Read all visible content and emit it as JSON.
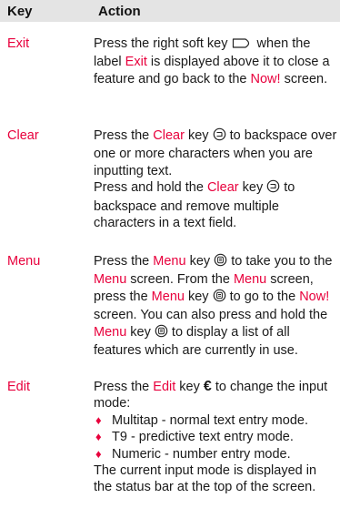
{
  "header": {
    "key": "Key",
    "action": "Action"
  },
  "entries": [
    {
      "key": "Exit",
      "p1_a": "Press the right soft key ",
      "icon": "right-soft-key-icon",
      "p1_b": " when the label ",
      "p1_hl": "Exit",
      "p1_c": " is displayed above it to close a feature and go back to the ",
      "p1_hl2": "Now!",
      "p1_d": " screen."
    },
    {
      "key": "Clear",
      "p1_a": "Press the ",
      "p1_hl": "Clear",
      "p1_b": " key ",
      "icon": "clear-key-icon",
      "p1_c": " to backspace over one or more characters when you are inputting text.",
      "p2_a": "Press and hold the ",
      "p2_hl": "Clear",
      "p2_b": " key ",
      "p2_c": " to backspace and remove multiple characters in a text field."
    },
    {
      "key": "Menu",
      "icon": "menu-key-icon",
      "a": "Press the ",
      "hl1": "Menu",
      "b": " key ",
      "c": " to take you to the ",
      "hl2": "Menu",
      "d": " screen. From the ",
      "hl3": "Menu",
      "e": " screen, press the ",
      "hl4": "Menu",
      "f": " key ",
      "g": " to go to the ",
      "hl5": "Now!",
      "h": " screen. You can also press and hold the ",
      "hl6": "Menu",
      "i": " key ",
      "j": " to display a list of all features which are currently in use."
    },
    {
      "key": "Edit",
      "icon": "edit-key-icon",
      "a": "Press the ",
      "hl1": "Edit",
      "b": " key ",
      "glyph": "€",
      "c": " to change the input mode:",
      "bullets": [
        "Multitap - normal text entry mode.",
        "T9 - predictive text entry mode.",
        "Numeric - number entry mode."
      ],
      "bullet_marker": "♦",
      "footer": "The current input mode is displayed in the status bar at the top of the screen."
    }
  ],
  "colors": {
    "accent": "#e8003c",
    "header_bg": "#e4e4e4",
    "text": "#1a1a1a"
  }
}
